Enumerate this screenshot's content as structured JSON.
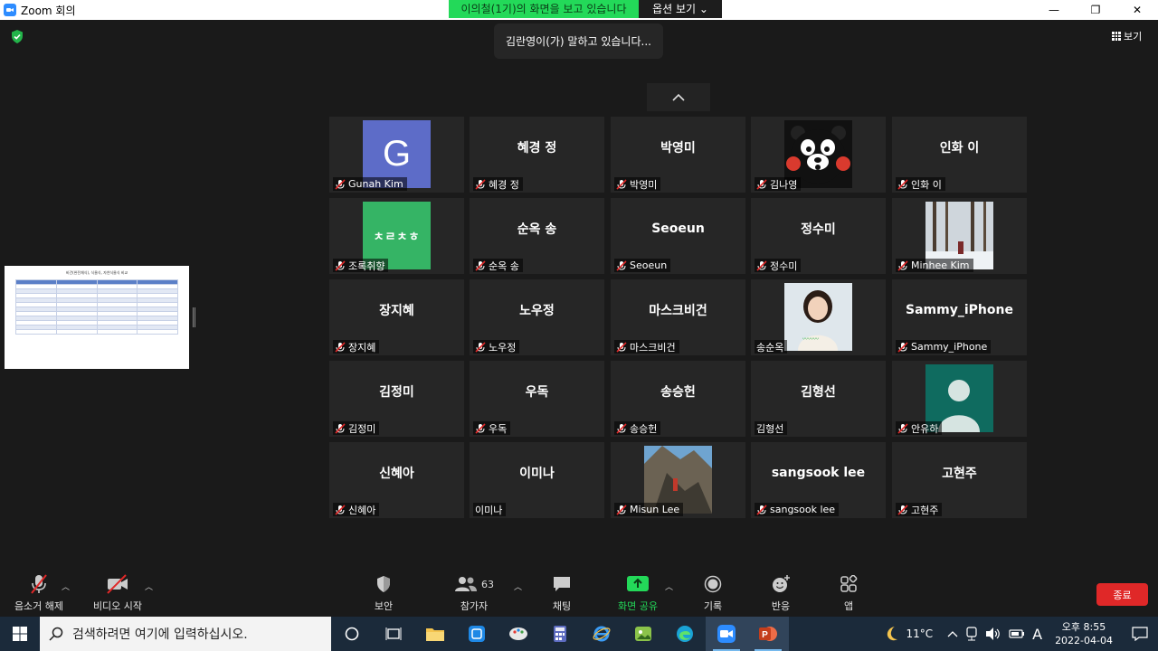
{
  "window": {
    "title": "Zoom 회의"
  },
  "share_banner": {
    "text": "이의철(1기)의 화면을 보고 있습니다",
    "options": "옵션 보기 ⌄"
  },
  "speaking": "김란영이(가) 말하고 있습니다...",
  "view": "보기",
  "participants": [
    {
      "name": "Gunah Kim",
      "display": "G",
      "type": "avatar",
      "muted": true
    },
    {
      "name": "혜경 정",
      "display": "혜경 정",
      "type": "text",
      "muted": true
    },
    {
      "name": "박영미",
      "display": "박영미",
      "type": "text",
      "muted": true
    },
    {
      "name": "김나영",
      "display": "",
      "type": "bear",
      "muted": true
    },
    {
      "name": "인화 이",
      "display": "인화 이",
      "type": "text",
      "muted": true
    },
    {
      "name": "조록취향",
      "display": "ㅊㄹㅊㅎ",
      "type": "green",
      "muted": true
    },
    {
      "name": "순옥 송",
      "display": "순옥 송",
      "type": "text",
      "muted": true
    },
    {
      "name": "Seoeun",
      "display": "Seoeun",
      "type": "text",
      "muted": true
    },
    {
      "name": "정수미",
      "display": "정수미",
      "type": "text",
      "muted": true
    },
    {
      "name": "Minhee Kim",
      "display": "",
      "type": "snow",
      "muted": true
    },
    {
      "name": "장지혜",
      "display": "장지혜",
      "type": "text",
      "muted": true
    },
    {
      "name": "노우정",
      "display": "노우정",
      "type": "text",
      "muted": true
    },
    {
      "name": "마스크비건",
      "display": "마스크비건",
      "type": "text",
      "muted": true
    },
    {
      "name": "송순옥",
      "display": "",
      "type": "girl",
      "muted": false
    },
    {
      "name": "Sammy_iPhone",
      "display": "Sammy_iPhone",
      "type": "text",
      "muted": true
    },
    {
      "name": "김정미",
      "display": "김정미",
      "type": "text",
      "muted": true
    },
    {
      "name": "우독",
      "display": "우독",
      "type": "text",
      "muted": true
    },
    {
      "name": "송승헌",
      "display": "송승헌",
      "type": "text",
      "muted": true
    },
    {
      "name": "김형선",
      "display": "김형선",
      "type": "text",
      "muted": false
    },
    {
      "name": "안유하",
      "display": "",
      "type": "person",
      "muted": true
    },
    {
      "name": "신혜아",
      "display": "신혜아",
      "type": "text",
      "muted": true
    },
    {
      "name": "이미나",
      "display": "이미나",
      "type": "text",
      "muted": false
    },
    {
      "name": "Misun Lee",
      "display": "",
      "type": "rock",
      "muted": true
    },
    {
      "name": "sangsook lee",
      "display": "sangsook lee",
      "type": "text",
      "muted": true
    },
    {
      "name": "고현주",
      "display": "고현주",
      "type": "text",
      "muted": true
    }
  ],
  "shared_slide": {
    "title": "비건(완전채식), 식물식, 자연식물식 비교"
  },
  "toolbar": {
    "unmute": "음소거 해제",
    "video": "비디오 시작",
    "security": "보안",
    "participants": "참가자",
    "participants_count": "63",
    "chat": "채팅",
    "share": "화면 공유",
    "record": "기록",
    "reactions": "반응",
    "apps": "앱",
    "end": "종료"
  },
  "taskbar": {
    "search_placeholder": "검색하려면 여기에 입력하십시오.",
    "temperature": "11°C",
    "ime": "A",
    "time": "오후 8:55",
    "date": "2022-04-04"
  }
}
